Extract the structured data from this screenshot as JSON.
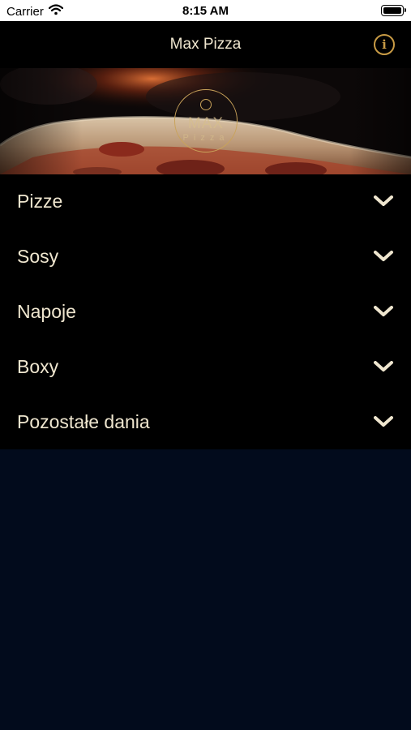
{
  "status_bar": {
    "carrier": "Carrier",
    "time": "8:15 AM"
  },
  "nav": {
    "title": "Max Pizza",
    "info_icon": "info-icon",
    "info_glyph": "i",
    "accent_color": "#c89b45"
  },
  "hero": {
    "logo_word": "MAX",
    "logo_sub": "Pizza"
  },
  "menu": {
    "items": [
      {
        "label": "Pizze",
        "icon": "chevron-down-icon"
      },
      {
        "label": "Sosy",
        "icon": "chevron-down-icon"
      },
      {
        "label": "Napoje",
        "icon": "chevron-down-icon"
      },
      {
        "label": "Boxy",
        "icon": "chevron-down-icon"
      },
      {
        "label": "Pozostałe dania",
        "icon": "chevron-down-icon"
      }
    ]
  },
  "colors": {
    "text": "#efe6cf",
    "menu_background": "#000000",
    "page_background": "#020b1c"
  }
}
